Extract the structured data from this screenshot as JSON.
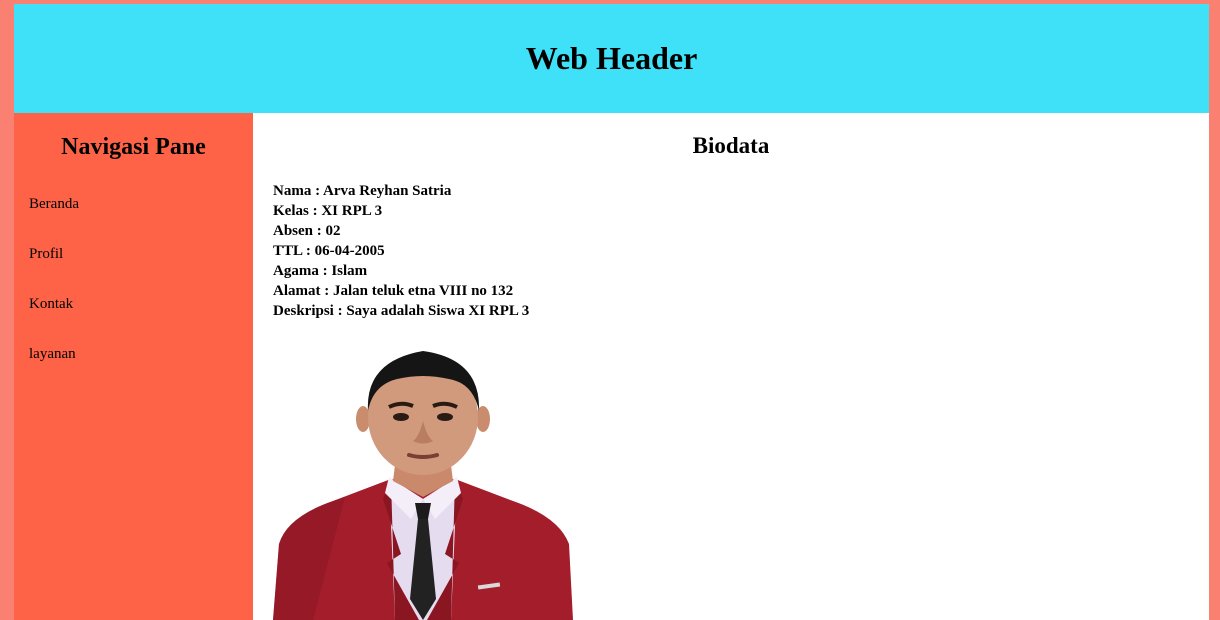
{
  "header": {
    "title": "Web Header"
  },
  "sidebar": {
    "title": "Navigasi Pane",
    "items": [
      {
        "label": "Beranda"
      },
      {
        "label": "Profil"
      },
      {
        "label": "Kontak"
      },
      {
        "label": "layanan"
      }
    ]
  },
  "main": {
    "title": "Biodata",
    "bio": [
      "Nama : Arva Reyhan Satria",
      "Kelas : XI RPL 3",
      "Absen : 02",
      "TTL : 06-04-2005",
      "Agama : Islam",
      "Alamat : Jalan teluk etna VIII no 132",
      "Deskripsi : Saya adalah Siswa XI RPL 3"
    ]
  },
  "colors": {
    "page_background": "#fa8072",
    "header_background": "#3ee1f8",
    "sidebar_background": "#ff6347",
    "main_background": "#ffffff",
    "jacket": "#a31d2b"
  }
}
